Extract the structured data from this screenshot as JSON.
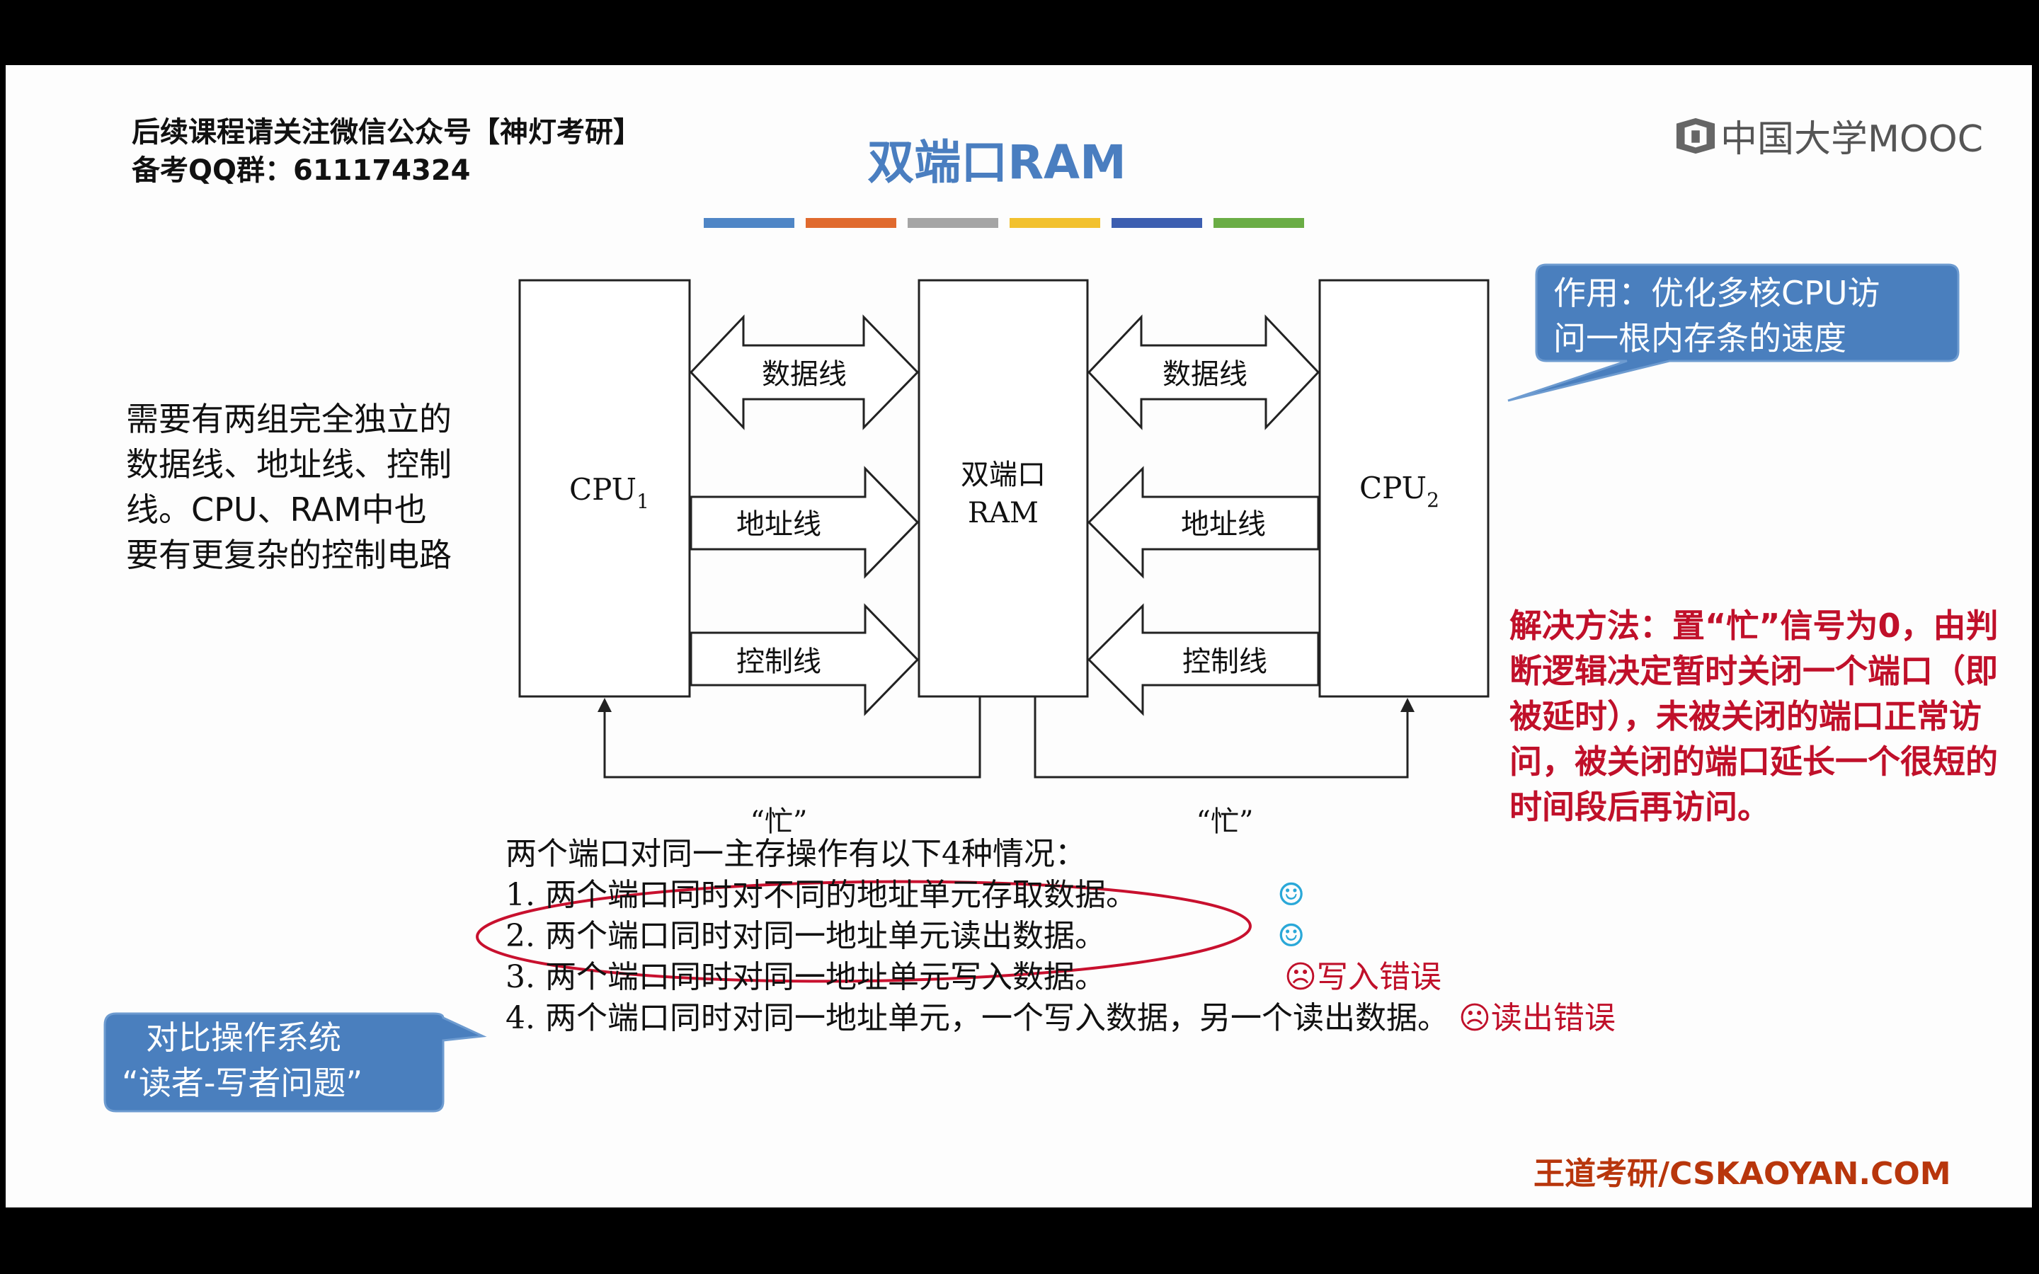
{
  "header": {
    "line1": "后续课程请关注微信公众号【神灯考研】",
    "line2": "备考QQ群：611174324",
    "title": "双端口RAM",
    "logo": "中国大学MOOC"
  },
  "colors": {
    "bars": [
      "#4f86c6",
      "#e06a2e",
      "#a5a5a5",
      "#f2c12e",
      "#3c5eb0",
      "#6aad45"
    ],
    "callout_blue": "#4a7fbe",
    "red": "#c0102a"
  },
  "left_note": "需要有两组完全独立的数据线、地址线、控制线。CPU、RAM中也要有更复杂的控制电路",
  "callout_top": {
    "line1": "作用：优化多核CPU访",
    "line2": "问一根内存条的速度"
  },
  "callout_bottom": {
    "line1": "对比操作系统",
    "line2": "“读者-写者问题”"
  },
  "diagram": {
    "cpu1": "CPU",
    "cpu1_sub": "1",
    "cpu2": "CPU",
    "cpu2_sub": "2",
    "ram_line1": "双端口",
    "ram_line2": "RAM",
    "data_line": "数据线",
    "addr_line": "地址线",
    "ctrl_line": "控制线",
    "busy": "“忙”"
  },
  "solution": "解决方法：置“忙”信号为0，由判断逻辑决定暂时关闭一个端口（即被延时），未被关闭的端口正常访问，被关闭的端口延长一个很短的时间段后再访问。",
  "cases": {
    "intro": "两个端口对同一主存操作有以下4种情况：",
    "c1": "1. 两个端口同时对不同的地址单元存取数据。",
    "c2": "2. 两个端口同时对同一地址单元读出数据。",
    "c3": "3. 两个端口同时对同一地址单元写入数据。",
    "c4": "4. 两个端口同时对同一地址单元，一个写入数据，另一个读出数据。",
    "ok_icon": "☺",
    "bad_icon": "☹",
    "err3": "写入错误",
    "err4": "读出错误"
  },
  "footer": "王道考研/CSKAOYAN.COM"
}
